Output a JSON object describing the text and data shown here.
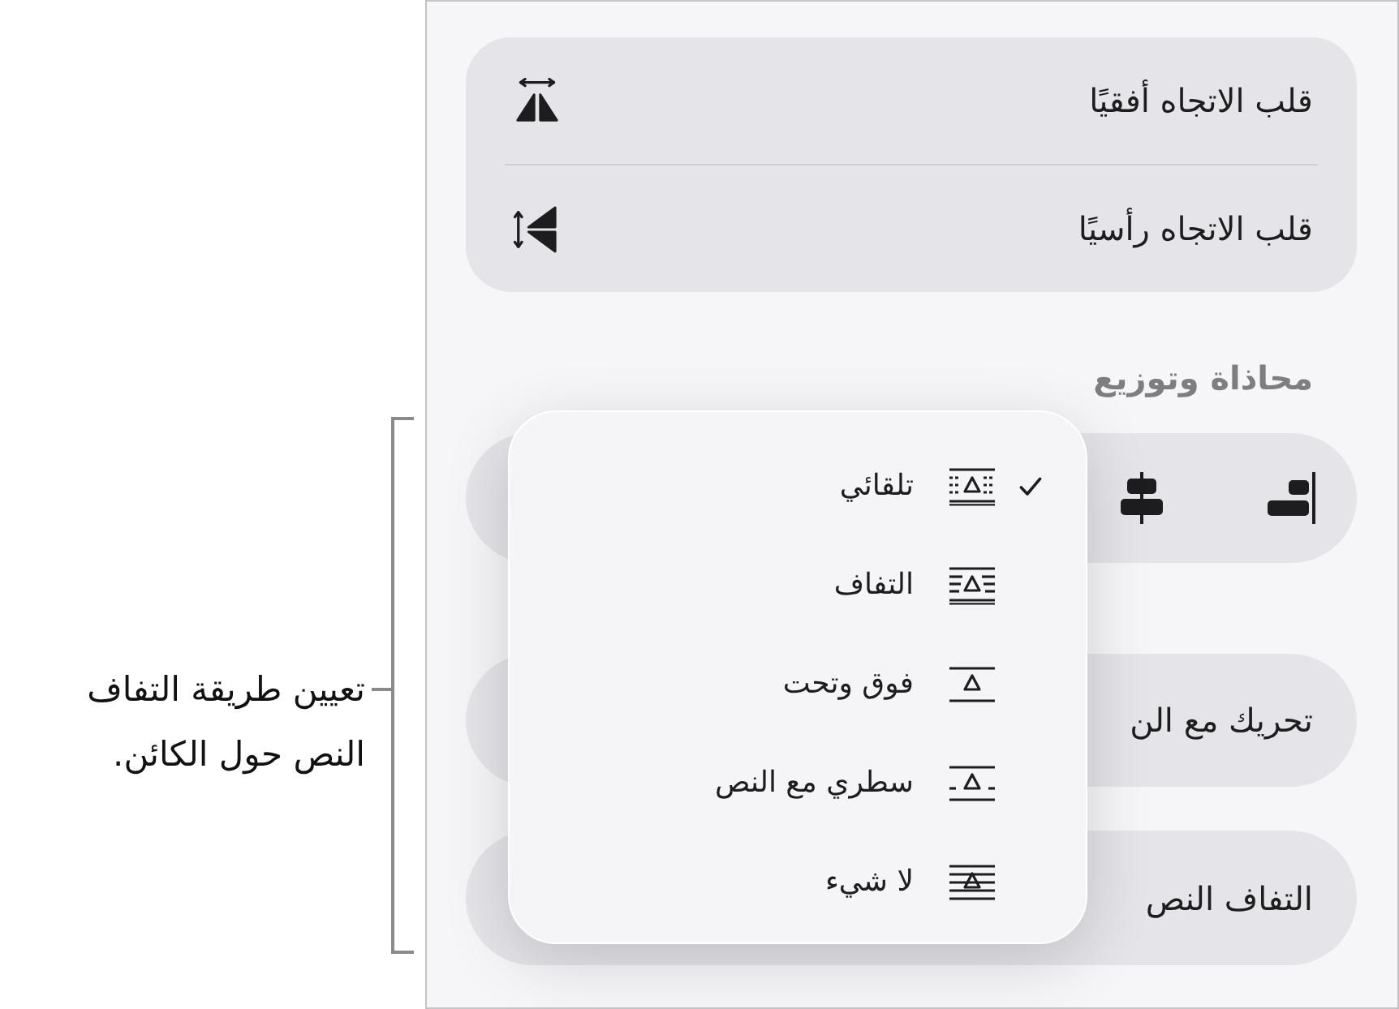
{
  "callout": {
    "text": "تعيين طريقة التفاف النص حول الكائن."
  },
  "flip_card": {
    "items": [
      {
        "label": "قلب الاتجاه أفقيًا",
        "kind": "horizontal"
      },
      {
        "label": "قلب الاتجاه رأسيًا",
        "kind": "vertical"
      }
    ]
  },
  "align_section": {
    "title": "محاذاة وتوزيع"
  },
  "move_with_text": {
    "label": "تحريك مع الن"
  },
  "text_wrap": {
    "label": "التفاف النص"
  },
  "wrap_menu": {
    "items": [
      {
        "label": "تلقائي",
        "kind": "auto",
        "selected": true
      },
      {
        "label": "التفاف",
        "kind": "around",
        "selected": false
      },
      {
        "label": "فوق وتحت",
        "kind": "above_below",
        "selected": false
      },
      {
        "label": "سطري مع النص",
        "kind": "inline",
        "selected": false
      },
      {
        "label": "لا شيء",
        "kind": "none",
        "selected": false
      }
    ]
  }
}
